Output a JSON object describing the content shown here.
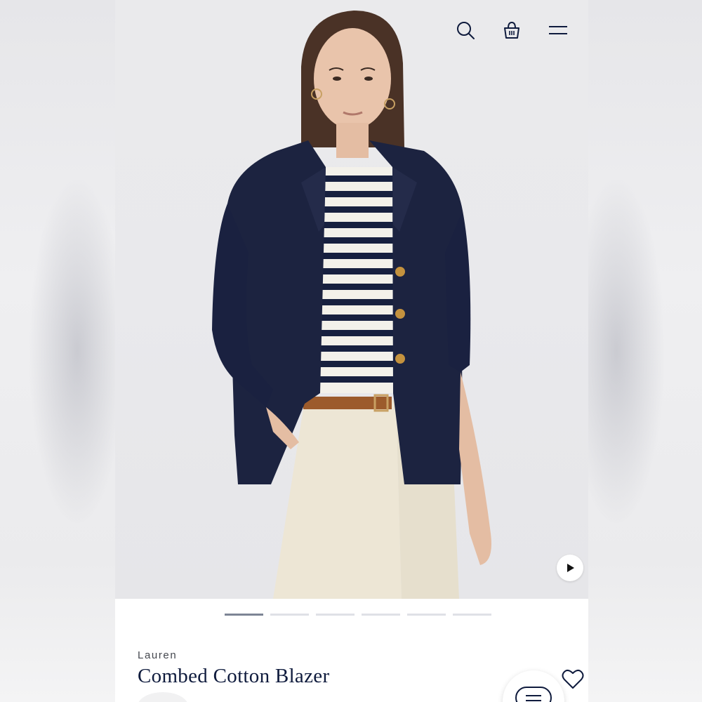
{
  "product": {
    "brand": "Lauren",
    "name": "Combed Cotton Blazer"
  },
  "carousel": {
    "total_slides": 6,
    "active_index": 0
  },
  "icons": {
    "search": "search-icon",
    "bag": "shopping-bag-icon",
    "menu": "hamburger-menu-icon",
    "play": "play-icon",
    "wishlist": "heart-icon",
    "chat": "chat-icon"
  },
  "colors": {
    "brand_navy": "#0f1b3d",
    "indicator_active": "#7d8595",
    "indicator_inactive": "#dfe1e6"
  }
}
